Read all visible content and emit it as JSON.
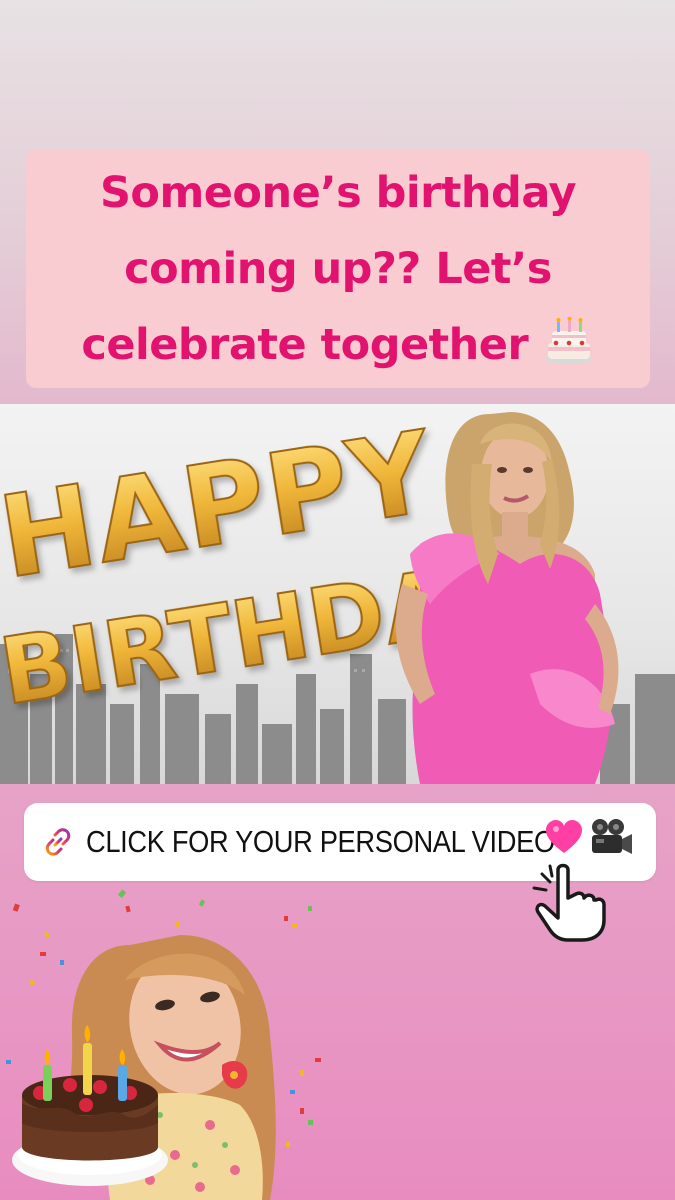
{
  "title": {
    "lines": [
      "Someone’s birthday",
      "coming up?? Let’s",
      "celebrate together"
    ],
    "emoji": "cake-icon"
  },
  "banner": {
    "balloon_top": "HAPPY",
    "balloon_bottom": "BIRTHDAY"
  },
  "link_sticker": {
    "label": "CLICK FOR YOUR PERSONAL VIDEO",
    "icons": [
      "link-icon",
      "pink-heart-icon",
      "video-camera-icon"
    ]
  },
  "colors": {
    "title_text": "#e2126f",
    "title_card": "#f9ccd1",
    "background_top": "#e7e2e4",
    "background_bottom": "#e88cc0",
    "dress": "#f05bb5",
    "balloon_gold": "#e0a52a"
  }
}
